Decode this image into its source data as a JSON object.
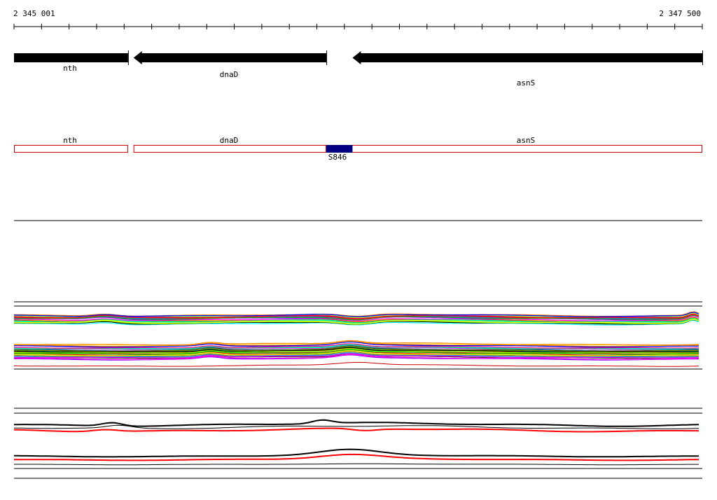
{
  "ruler": {
    "start_label": "2 345 001",
    "end_label": "2 347 500",
    "start": 2345001,
    "end": 2347500
  },
  "genes": [
    {
      "name": "nth",
      "strand": "+",
      "start": 2345001,
      "end": 2345415
    },
    {
      "name": "dnaD",
      "strand": "-",
      "start": 2345435,
      "end": 2346135
    },
    {
      "name": "asnS",
      "strand": "-",
      "start": 2346230,
      "end": 2347500
    }
  ],
  "regions": [
    {
      "name": "nth",
      "start": 2345001,
      "end": 2345415
    },
    {
      "name": "dnaD",
      "start": 2345435,
      "end": 2346135
    },
    {
      "name": "asnS",
      "start": 2346135,
      "end": 2347500
    }
  ],
  "feature": {
    "name": "S846",
    "start": 2346135,
    "end": 2346230
  },
  "colors": {
    "gene": "#000000",
    "region_outline": "#cc0000",
    "feature_fill": "#000080",
    "track_line": "#000000",
    "highlight": "#ff0000"
  }
}
